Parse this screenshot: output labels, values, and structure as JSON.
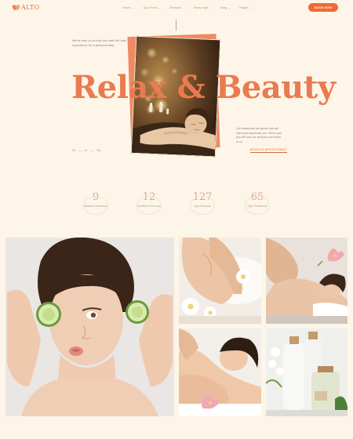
{
  "header": {
    "logo_text": "ALTO",
    "nav": [
      {
        "label": "Home"
      },
      {
        "label": "Spa Treat"
      },
      {
        "label": "Services"
      },
      {
        "label": "Menu Spa"
      },
      {
        "label": "Blog"
      },
      {
        "label": "Pages"
      }
    ],
    "book_button": "BOOK NOW"
  },
  "hero": {
    "intro": "We're here to provide you with the best experience for a pleasant stay.",
    "headline": "Relax & Beauty",
    "description": "Our treatments are gentle and will calm and rejuvenate you. We're sure you will love our services and return to us.",
    "cta_link": "BOOK AN APPOINTMENT",
    "socials": [
      "Fb",
      "In",
      "Tw"
    ]
  },
  "stats": [
    {
      "value": "9",
      "label": "Natural Cosmetics"
    },
    {
      "value": "12",
      "label": "Number of Rooms"
    },
    {
      "value": "127",
      "label": "Spa Products"
    },
    {
      "value": "65",
      "label": "Type Treatment"
    }
  ],
  "gallery": {
    "tiles": [
      {
        "alt": "woman-with-cucumber-slices"
      },
      {
        "alt": "foot-massage"
      },
      {
        "alt": "shoulder-massage"
      },
      {
        "alt": "back-massage"
      },
      {
        "alt": "spa-products-bottles"
      }
    ]
  },
  "colors": {
    "accent": "#ee6a36",
    "headline": "#ea7a4f",
    "background": "#fdf6e8",
    "stat_number": "#d9a792"
  }
}
